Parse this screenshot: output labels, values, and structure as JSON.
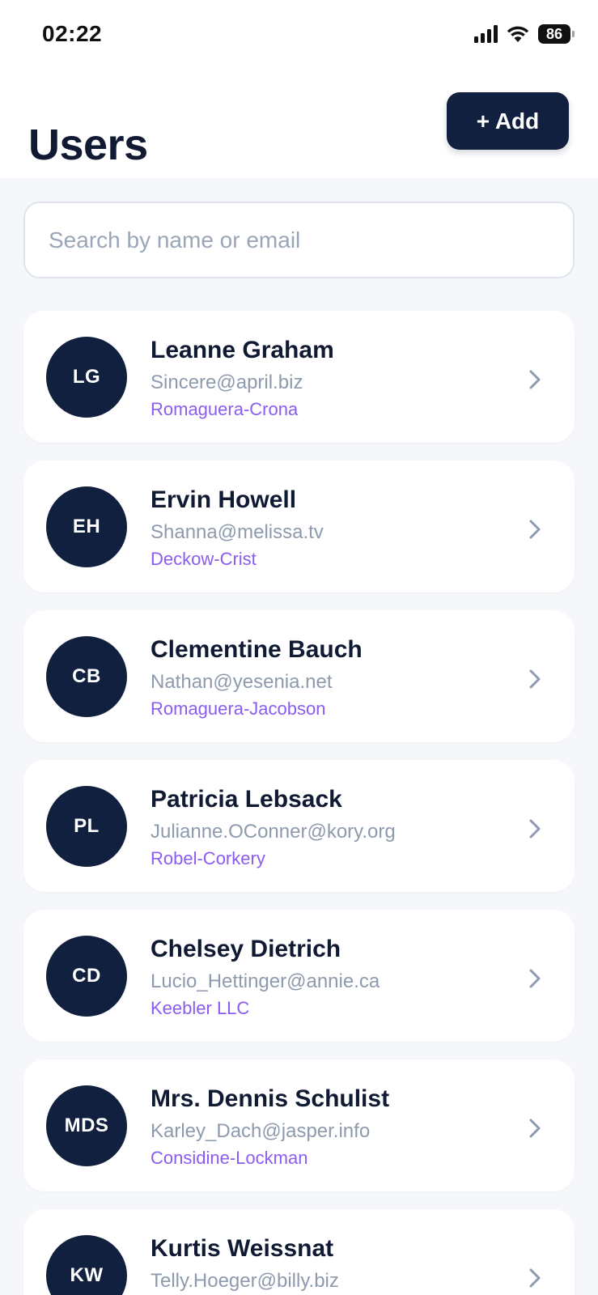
{
  "status_bar": {
    "time": "02:22",
    "battery": "86"
  },
  "header": {
    "title": "Users",
    "add_label": "+ Add"
  },
  "search": {
    "placeholder": "Search by name or email",
    "value": ""
  },
  "users": [
    {
      "initials": "LG",
      "name": "Leanne Graham",
      "email": "Sincere@april.biz",
      "company": "Romaguera-Crona"
    },
    {
      "initials": "EH",
      "name": "Ervin Howell",
      "email": "Shanna@melissa.tv",
      "company": "Deckow-Crist"
    },
    {
      "initials": "CB",
      "name": "Clementine Bauch",
      "email": "Nathan@yesenia.net",
      "company": "Romaguera-Jacobson"
    },
    {
      "initials": "PL",
      "name": "Patricia Lebsack",
      "email": "Julianne.OConner@kory.org",
      "company": "Robel-Corkery"
    },
    {
      "initials": "CD",
      "name": "Chelsey Dietrich",
      "email": "Lucio_Hettinger@annie.ca",
      "company": "Keebler LLC"
    },
    {
      "initials": "MDS",
      "name": "Mrs. Dennis Schulist",
      "email": "Karley_Dach@jasper.info",
      "company": "Considine-Lockman"
    },
    {
      "initials": "KW",
      "name": "Kurtis Weissnat",
      "email": "Telly.Hoeger@billy.biz",
      "company": ""
    }
  ],
  "colors": {
    "primary": "#12203f",
    "accent": "#8a5cf0",
    "muted": "#8e9aad",
    "background": "#f5f7fa"
  },
  "icons": {
    "signal": "signal-icon",
    "wifi": "wifi-icon",
    "battery": "battery-icon",
    "chevron": "chevron-right-icon"
  }
}
